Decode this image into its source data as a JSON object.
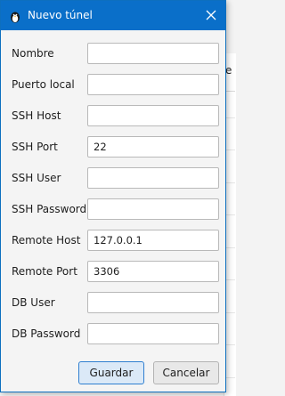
{
  "window": {
    "title": "Nuevo túnel",
    "close_icon": "close-icon",
    "app_icon": "penguin-app-icon"
  },
  "background": {
    "partial_header_text": "e"
  },
  "form": {
    "fields": [
      {
        "id": "nombre",
        "label": "Nombre",
        "value": ""
      },
      {
        "id": "puerto_local",
        "label": "Puerto local",
        "value": ""
      },
      {
        "id": "ssh_host",
        "label": "SSH Host",
        "value": ""
      },
      {
        "id": "ssh_port",
        "label": "SSH Port",
        "value": "22"
      },
      {
        "id": "ssh_user",
        "label": "SSH User",
        "value": ""
      },
      {
        "id": "ssh_password",
        "label": "SSH Password",
        "value": ""
      },
      {
        "id": "remote_host",
        "label": "Remote Host",
        "value": "127.0.0.1"
      },
      {
        "id": "remote_port",
        "label": "Remote Port",
        "value": "3306"
      },
      {
        "id": "db_user",
        "label": "DB User",
        "value": ""
      },
      {
        "id": "db_password",
        "label": "DB Password",
        "value": ""
      }
    ]
  },
  "buttons": {
    "save_label": "Guardar",
    "cancel_label": "Cancelar"
  },
  "colors": {
    "titlebar": "#0a6fc9",
    "primary_border": "#2f7fd0",
    "primary_fill": "#dbe9f7"
  }
}
